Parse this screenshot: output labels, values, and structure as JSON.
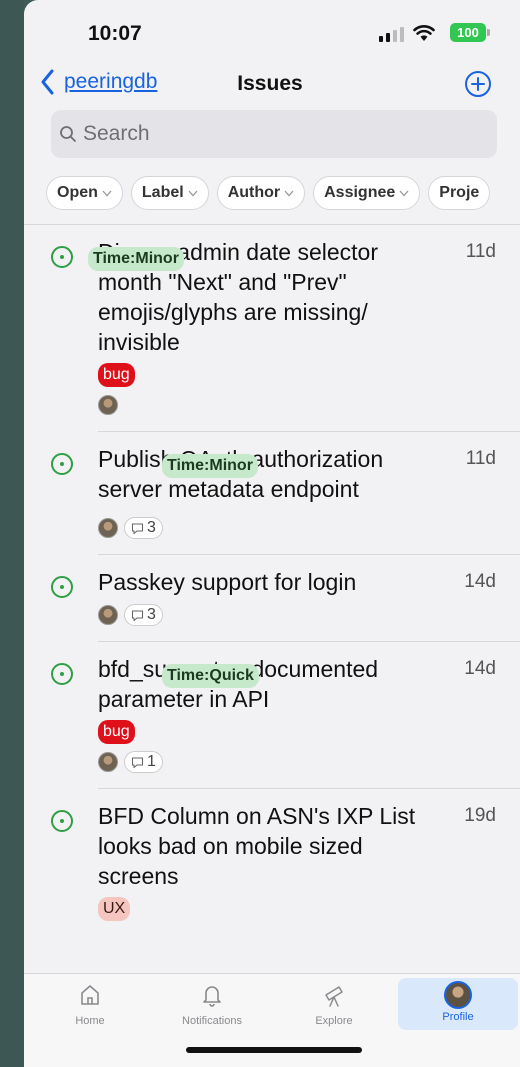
{
  "status": {
    "time": "10:07",
    "battery": "100"
  },
  "nav": {
    "back_label": "peeringdb",
    "title": "Issues"
  },
  "search": {
    "placeholder": "Search"
  },
  "filters": [
    "Open",
    "Label",
    "Author",
    "Assignee",
    "Proje"
  ],
  "issues": [
    {
      "title": "Django admin date selector month \"Next\" and \"Prev\" emojis/glyphs are missing/ invisible",
      "age": "11d",
      "labels": [
        {
          "text": "bug",
          "kind": "bug"
        },
        {
          "text": "Time:Minor",
          "kind": "time"
        }
      ],
      "comments": ""
    },
    {
      "title": "Publish OAuth authorization server metadata endpoint",
      "age": "11d",
      "labels": [
        {
          "text": "Time:Minor",
          "kind": "time"
        }
      ],
      "comments": "3"
    },
    {
      "title": "Passkey support for login",
      "age": "14d",
      "labels": [],
      "comments": "3"
    },
    {
      "title": "bfd_support undocumented parameter in API",
      "age": "14d",
      "labels": [
        {
          "text": "bug",
          "kind": "bug"
        },
        {
          "text": "Time:Quick",
          "kind": "time"
        }
      ],
      "comments": "1"
    },
    {
      "title": "BFD Column on ASN's IXP List looks bad on mobile sized screens",
      "age": "19d",
      "labels": [
        {
          "text": "UX",
          "kind": "ux"
        }
      ],
      "comments": ""
    }
  ],
  "tabbar": {
    "home": "Home",
    "notifications": "Notifications",
    "explore": "Explore",
    "profile": "Profile"
  },
  "colors": {
    "accent": "#1a63e0",
    "open_icon": "#2ea043",
    "bug": "#e0101a",
    "time_label": "#c6e9cb",
    "battery": "#31c752"
  }
}
